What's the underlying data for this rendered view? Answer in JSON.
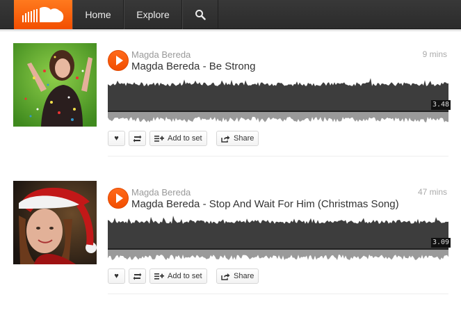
{
  "nav": {
    "home_label": "Home",
    "explore_label": "Explore"
  },
  "tracks": [
    {
      "artist": "Magda Bereda",
      "title": "Magda Bereda - Be Strong",
      "time_ago": "9 mins",
      "duration": "3.48",
      "actions": {
        "add_to_set": "Add to set",
        "share": "Share"
      }
    },
    {
      "artist": "Magda Bereda",
      "title": "Magda Bereda - Stop And Wait For Him (Christmas Song)",
      "time_ago": "47 mins",
      "duration": "3.09",
      "actions": {
        "add_to_set": "Add to set",
        "share": "Share"
      }
    }
  ],
  "colors": {
    "brand": "#ff5500",
    "topbar": "#333333",
    "waveform": "#3d3d3d"
  },
  "icons": [
    "soundcloud-logo-icon",
    "search-icon",
    "play-icon",
    "heart-icon",
    "repost-icon",
    "add-to-set-icon",
    "share-icon"
  ]
}
